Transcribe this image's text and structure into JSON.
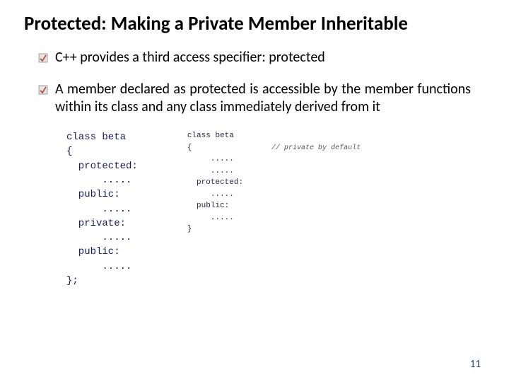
{
  "title": "Protected: Making a Private Member Inheritable",
  "bullets": [
    "C++ provides a third access specifier: protected",
    "A member declared as protected is accessible by the member functions within its class and any class immediately derived from it"
  ],
  "code_left": "class beta\n{\n  protected:\n      .....\n  public:\n      .....\n  private:\n      .....\n  public:\n      .....\n};",
  "code_right": "class beta\n{\n     .....\n     .....\n  protected:\n     .....\n  public:\n     .....\n}",
  "code_comment": "// private by default",
  "page_number": "11"
}
